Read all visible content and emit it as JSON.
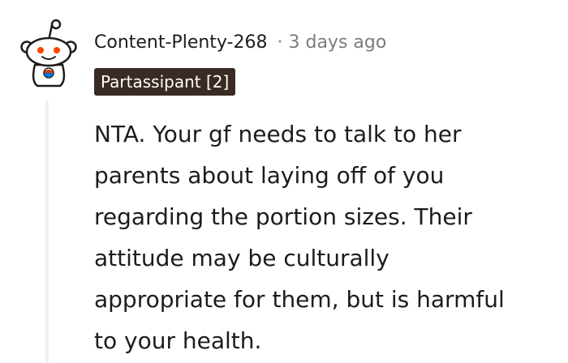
{
  "comment": {
    "username": "Content-Plenty-268",
    "separator": "·",
    "timestamp": "3 days ago",
    "flair": "Partassipant [2]",
    "avatar_icon": "snoo-avatar-icon",
    "body_lines": [
      "NTA. Your gf needs to talk to her",
      "parents about laying off of you",
      "regarding the portion sizes. Their",
      "attitude may be culturally",
      "appropriate for them, but is harmful",
      "to your health."
    ]
  },
  "colors": {
    "username": "#1c1c1c",
    "timestamp": "#7c7c7c",
    "flair_background": "#3a2a24",
    "flair_text": "#ffffff",
    "thread_line": "#edeff1"
  }
}
